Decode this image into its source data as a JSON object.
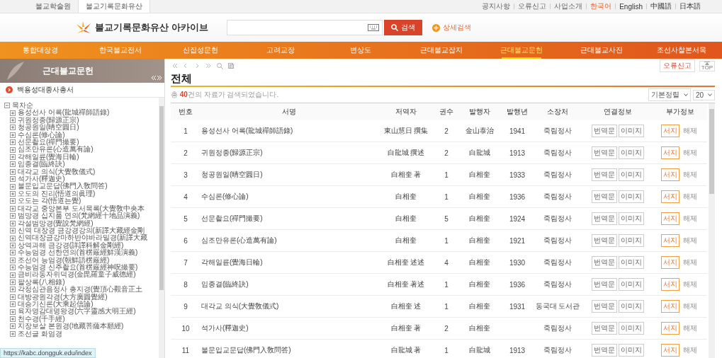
{
  "top_bar": {
    "sites": [
      {
        "label": "불교학술원",
        "selected": false
      },
      {
        "label": "불교기록문화유산",
        "selected": true
      }
    ],
    "links": [
      "공지사항",
      "오류신고",
      "사업소개"
    ],
    "languages": [
      {
        "label": "한국어",
        "selected": true
      },
      {
        "label": "English",
        "selected": false
      },
      {
        "label": "中國語",
        "selected": false
      },
      {
        "label": "日本語",
        "selected": false
      }
    ]
  },
  "header": {
    "logo": "불교기록문화유산 아카이브",
    "search_button": "검색",
    "advanced_search": "상세검색"
  },
  "nav": [
    {
      "label": "통합대장경",
      "selected": false
    },
    {
      "label": "한국불교전서",
      "selected": false
    },
    {
      "label": "신집성문헌",
      "selected": false
    },
    {
      "label": "고려교장",
      "selected": false
    },
    {
      "label": "변상도",
      "selected": false
    },
    {
      "label": "근대불교잡지",
      "selected": false
    },
    {
      "label": "근대불교문헌",
      "selected": true
    },
    {
      "label": "근대불교사진",
      "selected": false
    },
    {
      "label": "조선사찰본서목",
      "selected": false
    }
  ],
  "sidebar": {
    "title": "근대불교문헌",
    "collection": "백용성대종사총서",
    "tree": {
      "label": "목차순",
      "expanded": true,
      "children": [
        {
          "label": "용성선사 어록(龍城禪師語錄)",
          "expanded": false
        },
        {
          "label": "귀원정종(歸源正宗)",
          "expanded": false
        },
        {
          "label": "청공원일(晴空圓日)",
          "expanded": false
        },
        {
          "label": "수심론(修心論)",
          "expanded": false
        },
        {
          "label": "선문촬요(禪門撮要)",
          "expanded": false
        },
        {
          "label": "심조만유론(心造萬有論)",
          "expanded": false
        },
        {
          "label": "각해일륜(覺海日輪)",
          "expanded": false
        },
        {
          "label": "임종결(臨終訣)",
          "expanded": false
        },
        {
          "label": "대각교 의식(大覺敎儀式)",
          "expanded": false
        },
        {
          "label": "석가사(釋迦史)",
          "expanded": false
        },
        {
          "label": "불문입교문답(佛門入敎問答)",
          "expanded": false
        },
        {
          "label": "오도의 진리(悟道의眞理)",
          "expanded": false
        },
        {
          "label": "오도는 각(悟道는覺)",
          "expanded": false
        },
        {
          "label": "대각교 중앙본부 도서목록(大覺敎中央本",
          "expanded": false
        },
        {
          "label": "범망경 십지품 연의(梵網經十地品演義)",
          "expanded": false
        },
        {
          "label": "각설범망경(覺說梵網經)",
          "expanded": false
        },
        {
          "label": "신역 대장경 금강경강의(新譯大藏經金剛",
          "expanded": false
        },
        {
          "label": "신역대장금강마하반야바라밀경(新譯大藏",
          "expanded": false
        },
        {
          "label": "상역과해 금강경(詳譯科解金剛經)",
          "expanded": false
        },
        {
          "label": "수능엄경 선한연의(首楞嚴經鮮漢演義)",
          "expanded": false
        },
        {
          "label": "조선어 능엄경(朝鮮語楞嚴經)",
          "expanded": false
        },
        {
          "label": "수능엄경 신주촬요(首楞嚴經神呪撮要)",
          "expanded": false
        },
        {
          "label": "금비라동자위덕경(金毘羅童子威德經)",
          "expanded": false
        },
        {
          "label": "팔상록(八相錄)",
          "expanded": false
        },
        {
          "label": "각정심관음정사 총지경(覺頂心觀音正土",
          "expanded": false
        },
        {
          "label": "대방광원각경(大方廣圓覺經)",
          "expanded": false
        },
        {
          "label": "대승기신론(大乘起信論)",
          "expanded": false
        },
        {
          "label": "육자영감대명왕경(六字靈感大明王經)",
          "expanded": false
        },
        {
          "label": "천수경(千手經)",
          "expanded": false
        },
        {
          "label": "지장보살 본원경(地藏菩薩本願經)",
          "expanded": false
        },
        {
          "label": "조선글 화엄경",
          "expanded": false
        }
      ]
    }
  },
  "main": {
    "title": "전체",
    "result_text": "총 **40**건의 자료가 검색되었습니다.",
    "report_button": "오류신고",
    "top_button": "TOP",
    "sort": "기본정렬",
    "page_size": "20",
    "columns": [
      "번호",
      "서명",
      "저역자",
      "권수",
      "발행자",
      "발행년",
      "소장처",
      "연결정보",
      "부가정보"
    ],
    "rows": [
      {
        "no": "1",
        "title": "용성선사 어록(龍城禪師語錄)",
        "author": "東山慧日 撰集",
        "volumes": "2",
        "publisher": "金山泰治",
        "year": "1941",
        "holder": "죽림정사",
        "links": [
          "번역문",
          "이미지"
        ],
        "extras": [
          {
            "label": "서지",
            "disabled": false
          },
          {
            "label": "해제",
            "disabled": true
          }
        ]
      },
      {
        "no": "2",
        "title": "귀원정종(歸源正宗)",
        "author": "白龍城 撰述",
        "volumes": "2",
        "publisher": "白龍城",
        "year": "1913",
        "holder": "죽림정사",
        "links": [
          "번역문",
          "이미지"
        ],
        "extras": [
          {
            "label": "서지",
            "disabled": false
          },
          {
            "label": "해제",
            "disabled": true
          }
        ]
      },
      {
        "no": "3",
        "title": "청공원일(晴空圓日)",
        "author": "白相奎 著",
        "volumes": "1",
        "publisher": "白相奎",
        "year": "1933",
        "holder": "죽림정사",
        "links": [
          "번역문",
          "이미지"
        ],
        "extras": [
          {
            "label": "서지",
            "disabled": false
          },
          {
            "label": "해제",
            "disabled": true
          }
        ]
      },
      {
        "no": "4",
        "title": "수심론(修心論)",
        "author": "白相奎",
        "volumes": "1",
        "publisher": "白相奎",
        "year": "1936",
        "holder": "죽림정사",
        "links": [
          "번역문",
          "이미지"
        ],
        "extras": [
          {
            "label": "서지",
            "disabled": false
          },
          {
            "label": "해제",
            "disabled": true
          }
        ]
      },
      {
        "no": "5",
        "title": "선문촬요(禪門撮要)",
        "author": "白相奎",
        "volumes": "5",
        "publisher": "白相奎",
        "year": "1924",
        "holder": "죽림정사",
        "links": [
          "번역문",
          "이미지"
        ],
        "extras": [
          {
            "label": "서지",
            "disabled": false
          },
          {
            "label": "해제",
            "disabled": true
          }
        ]
      },
      {
        "no": "6",
        "title": "심조만유론(心造萬有論)",
        "author": "白相奎",
        "volumes": "1",
        "publisher": "白相奎",
        "year": "1921",
        "holder": "죽림정사",
        "links": [
          "번역문",
          "이미지"
        ],
        "extras": [
          {
            "label": "서지",
            "disabled": false
          },
          {
            "label": "해제",
            "disabled": true
          }
        ]
      },
      {
        "no": "7",
        "title": "각해일륜(覺海日輪)",
        "author": "白相奎 述述",
        "volumes": "4",
        "publisher": "白相奎",
        "year": "1930",
        "holder": "죽림정사",
        "links": [
          "번역문",
          "이미지"
        ],
        "extras": [
          {
            "label": "서지",
            "disabled": false
          },
          {
            "label": "해제",
            "disabled": true
          }
        ]
      },
      {
        "no": "8",
        "title": "임종결(臨終訣)",
        "author": "白相奎 著述",
        "volumes": "1",
        "publisher": "白相奎",
        "year": "1936",
        "holder": "죽림정사",
        "links": [
          "번역문",
          "이미지"
        ],
        "extras": [
          {
            "label": "서지",
            "disabled": false
          },
          {
            "label": "해제",
            "disabled": true
          }
        ]
      },
      {
        "no": "9",
        "title": "대각교 의식(大覺敎儀式)",
        "author": "白相奎 述",
        "volumes": "1",
        "publisher": "白相奎",
        "year": "1931",
        "holder": "동국대 도서관",
        "links": [
          "번역문",
          "이미지"
        ],
        "extras": [
          {
            "label": "서지",
            "disabled": false
          },
          {
            "label": "해제",
            "disabled": true
          }
        ]
      },
      {
        "no": "10",
        "title": "석가사(釋迦史)",
        "author": "白相奎 著",
        "volumes": "2",
        "publisher": "白相奎",
        "holder": "죽림정사",
        "links": [
          "번역문",
          "이미지"
        ],
        "extras": [
          {
            "label": "서지",
            "disabled": false
          },
          {
            "label": "해제",
            "disabled": true
          }
        ]
      },
      {
        "no": "11",
        "title": "불문입교문답(佛門入敎問答)",
        "author": "白龍城 著",
        "volumes": "1",
        "publisher": "白龍城",
        "year": "1913",
        "holder": "죽림정사",
        "links": [
          "번역문",
          "이미지"
        ],
        "extras": [
          {
            "label": "서지",
            "disabled": false
          },
          {
            "label": "해제",
            "disabled": true
          }
        ]
      }
    ]
  },
  "status_url": "https://kabc.dongguk.edu/index"
}
